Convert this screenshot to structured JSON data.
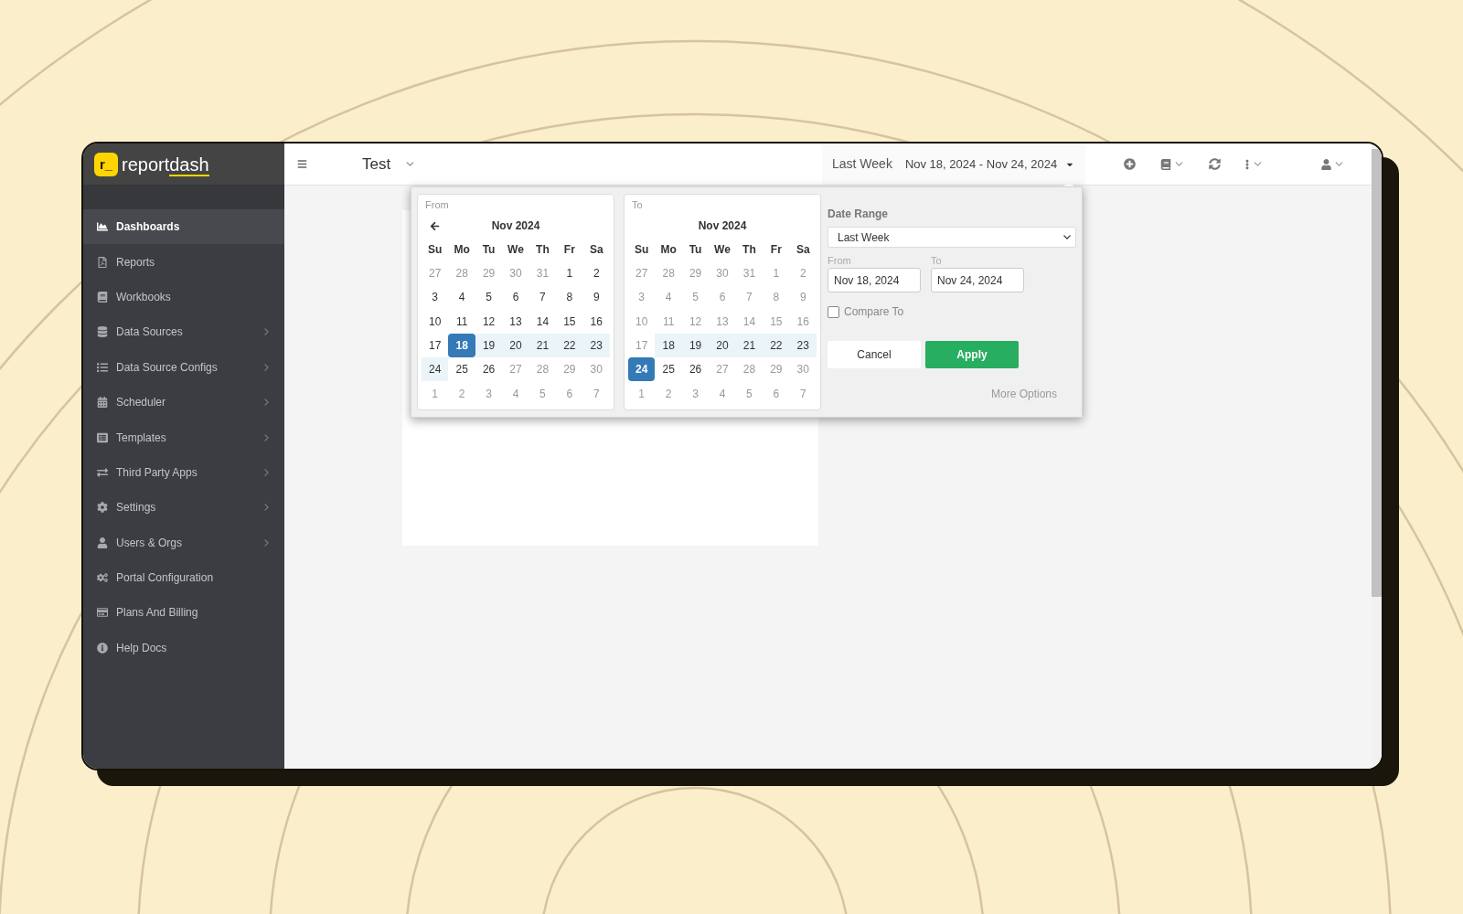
{
  "sidebar": {
    "logo": {
      "mark": "r_",
      "wordmark": "report",
      "wordmark_underlined_part": "dash"
    },
    "items": [
      {
        "label": "Dashboards",
        "selected": true,
        "has_submenu": false
      },
      {
        "label": "Reports",
        "selected": false,
        "has_submenu": false
      },
      {
        "label": "Workbooks",
        "selected": false,
        "has_submenu": false
      },
      {
        "label": "Data Sources",
        "selected": false,
        "has_submenu": true
      },
      {
        "label": "Data Source Configs",
        "selected": false,
        "has_submenu": true
      },
      {
        "label": "Scheduler",
        "selected": false,
        "has_submenu": true
      },
      {
        "label": "Templates",
        "selected": false,
        "has_submenu": true
      },
      {
        "label": "Third Party Apps",
        "selected": false,
        "has_submenu": true
      },
      {
        "label": "Settings",
        "selected": false,
        "has_submenu": true
      },
      {
        "label": "Users & Orgs",
        "selected": false,
        "has_submenu": true
      },
      {
        "label": "Portal Configuration",
        "selected": false,
        "has_submenu": false
      },
      {
        "label": "Plans And Billing",
        "selected": false,
        "has_submenu": false
      },
      {
        "label": "Help Docs",
        "selected": false,
        "has_submenu": false
      }
    ]
  },
  "top_bar": {
    "dashboard_title": "Test",
    "date_button": {
      "preset": "Last Week",
      "range": "Nov 18, 2024 - Nov 24, 2024"
    }
  },
  "date_picker": {
    "calendars": [
      {
        "label": "From",
        "month": "Nov 2024",
        "prev_arrow": true,
        "weekdays": [
          "Su",
          "Mo",
          "Tu",
          "We",
          "Th",
          "Fr",
          "Sa"
        ],
        "weeks": [
          [
            {
              "day": "27",
              "muted": true,
              "in_range": false,
              "selected": false
            },
            {
              "day": "28",
              "muted": true,
              "in_range": false,
              "selected": false
            },
            {
              "day": "29",
              "muted": true,
              "in_range": false,
              "selected": false
            },
            {
              "day": "30",
              "muted": true,
              "in_range": false,
              "selected": false
            },
            {
              "day": "31",
              "muted": true,
              "in_range": false,
              "selected": false
            },
            {
              "day": "1",
              "muted": false,
              "in_range": false,
              "selected": false
            },
            {
              "day": "2",
              "muted": false,
              "in_range": false,
              "selected": false
            }
          ],
          [
            {
              "day": "3",
              "muted": false,
              "in_range": false,
              "selected": false
            },
            {
              "day": "4",
              "muted": false,
              "in_range": false,
              "selected": false
            },
            {
              "day": "5",
              "muted": false,
              "in_range": false,
              "selected": false
            },
            {
              "day": "6",
              "muted": false,
              "in_range": false,
              "selected": false
            },
            {
              "day": "7",
              "muted": false,
              "in_range": false,
              "selected": false
            },
            {
              "day": "8",
              "muted": false,
              "in_range": false,
              "selected": false
            },
            {
              "day": "9",
              "muted": false,
              "in_range": false,
              "selected": false
            }
          ],
          [
            {
              "day": "10",
              "muted": false,
              "in_range": false,
              "selected": false
            },
            {
              "day": "11",
              "muted": false,
              "in_range": false,
              "selected": false
            },
            {
              "day": "12",
              "muted": false,
              "in_range": false,
              "selected": false
            },
            {
              "day": "13",
              "muted": false,
              "in_range": false,
              "selected": false
            },
            {
              "day": "14",
              "muted": false,
              "in_range": false,
              "selected": false
            },
            {
              "day": "15",
              "muted": false,
              "in_range": false,
              "selected": false
            },
            {
              "day": "16",
              "muted": false,
              "in_range": false,
              "selected": false
            }
          ],
          [
            {
              "day": "17",
              "muted": false,
              "in_range": false,
              "selected": false
            },
            {
              "day": "18",
              "muted": false,
              "in_range": false,
              "selected": true
            },
            {
              "day": "19",
              "muted": false,
              "in_range": true,
              "selected": false
            },
            {
              "day": "20",
              "muted": false,
              "in_range": true,
              "selected": false
            },
            {
              "day": "21",
              "muted": false,
              "in_range": true,
              "selected": false
            },
            {
              "day": "22",
              "muted": false,
              "in_range": true,
              "selected": false
            },
            {
              "day": "23",
              "muted": false,
              "in_range": true,
              "selected": false
            }
          ],
          [
            {
              "day": "24",
              "muted": false,
              "in_range": true,
              "selected": false
            },
            {
              "day": "25",
              "muted": false,
              "in_range": false,
              "selected": false
            },
            {
              "day": "26",
              "muted": false,
              "in_range": false,
              "selected": false
            },
            {
              "day": "27",
              "muted": true,
              "in_range": false,
              "selected": false
            },
            {
              "day": "28",
              "muted": true,
              "in_range": false,
              "selected": false
            },
            {
              "day": "29",
              "muted": true,
              "in_range": false,
              "selected": false
            },
            {
              "day": "30",
              "muted": true,
              "in_range": false,
              "selected": false
            }
          ],
          [
            {
              "day": "1",
              "muted": true,
              "in_range": false,
              "selected": false
            },
            {
              "day": "2",
              "muted": true,
              "in_range": false,
              "selected": false
            },
            {
              "day": "3",
              "muted": true,
              "in_range": false,
              "selected": false
            },
            {
              "day": "4",
              "muted": true,
              "in_range": false,
              "selected": false
            },
            {
              "day": "5",
              "muted": true,
              "in_range": false,
              "selected": false
            },
            {
              "day": "6",
              "muted": true,
              "in_range": false,
              "selected": false
            },
            {
              "day": "7",
              "muted": true,
              "in_range": false,
              "selected": false
            }
          ]
        ]
      },
      {
        "label": "To",
        "month": "Nov 2024",
        "prev_arrow": false,
        "weekdays": [
          "Su",
          "Mo",
          "Tu",
          "We",
          "Th",
          "Fr",
          "Sa"
        ],
        "weeks": [
          [
            {
              "day": "27",
              "muted": true,
              "in_range": false,
              "selected": false
            },
            {
              "day": "28",
              "muted": true,
              "in_range": false,
              "selected": false
            },
            {
              "day": "29",
              "muted": true,
              "in_range": false,
              "selected": false
            },
            {
              "day": "30",
              "muted": true,
              "in_range": false,
              "selected": false
            },
            {
              "day": "31",
              "muted": true,
              "in_range": false,
              "selected": false
            },
            {
              "day": "1",
              "muted": true,
              "in_range": false,
              "selected": false
            },
            {
              "day": "2",
              "muted": true,
              "in_range": false,
              "selected": false
            }
          ],
          [
            {
              "day": "3",
              "muted": true,
              "in_range": false,
              "selected": false
            },
            {
              "day": "4",
              "muted": true,
              "in_range": false,
              "selected": false
            },
            {
              "day": "5",
              "muted": true,
              "in_range": false,
              "selected": false
            },
            {
              "day": "6",
              "muted": true,
              "in_range": false,
              "selected": false
            },
            {
              "day": "7",
              "muted": true,
              "in_range": false,
              "selected": false
            },
            {
              "day": "8",
              "muted": true,
              "in_range": false,
              "selected": false
            },
            {
              "day": "9",
              "muted": true,
              "in_range": false,
              "selected": false
            }
          ],
          [
            {
              "day": "10",
              "muted": true,
              "in_range": false,
              "selected": false
            },
            {
              "day": "11",
              "muted": true,
              "in_range": false,
              "selected": false
            },
            {
              "day": "12",
              "muted": true,
              "in_range": false,
              "selected": false
            },
            {
              "day": "13",
              "muted": true,
              "in_range": false,
              "selected": false
            },
            {
              "day": "14",
              "muted": true,
              "in_range": false,
              "selected": false
            },
            {
              "day": "15",
              "muted": true,
              "in_range": false,
              "selected": false
            },
            {
              "day": "16",
              "muted": true,
              "in_range": false,
              "selected": false
            }
          ],
          [
            {
              "day": "17",
              "muted": true,
              "in_range": false,
              "selected": false
            },
            {
              "day": "18",
              "muted": false,
              "in_range": true,
              "selected": false
            },
            {
              "day": "19",
              "muted": false,
              "in_range": true,
              "selected": false
            },
            {
              "day": "20",
              "muted": false,
              "in_range": true,
              "selected": false
            },
            {
              "day": "21",
              "muted": false,
              "in_range": true,
              "selected": false
            },
            {
              "day": "22",
              "muted": false,
              "in_range": true,
              "selected": false
            },
            {
              "day": "23",
              "muted": false,
              "in_range": true,
              "selected": false
            }
          ],
          [
            {
              "day": "24",
              "muted": false,
              "in_range": false,
              "selected": true
            },
            {
              "day": "25",
              "muted": false,
              "in_range": false,
              "selected": false
            },
            {
              "day": "26",
              "muted": false,
              "in_range": false,
              "selected": false
            },
            {
              "day": "27",
              "muted": true,
              "in_range": false,
              "selected": false
            },
            {
              "day": "28",
              "muted": true,
              "in_range": false,
              "selected": false
            },
            {
              "day": "29",
              "muted": true,
              "in_range": false,
              "selected": false
            },
            {
              "day": "30",
              "muted": true,
              "in_range": false,
              "selected": false
            }
          ],
          [
            {
              "day": "1",
              "muted": true,
              "in_range": false,
              "selected": false
            },
            {
              "day": "2",
              "muted": true,
              "in_range": false,
              "selected": false
            },
            {
              "day": "3",
              "muted": true,
              "in_range": false,
              "selected": false
            },
            {
              "day": "4",
              "muted": true,
              "in_range": false,
              "selected": false
            },
            {
              "day": "5",
              "muted": true,
              "in_range": false,
              "selected": false
            },
            {
              "day": "6",
              "muted": true,
              "in_range": false,
              "selected": false
            },
            {
              "day": "7",
              "muted": true,
              "in_range": false,
              "selected": false
            }
          ]
        ]
      }
    ],
    "date_range": {
      "label": "Date Range",
      "value": "Last Week"
    },
    "from": {
      "label": "From",
      "value": "Nov 18, 2024"
    },
    "to": {
      "label": "To",
      "value": "Nov 24, 2024"
    },
    "compare": {
      "label": "Compare To",
      "checked": false
    },
    "buttons": [
      {
        "label": "Cancel",
        "kind": "secondary"
      },
      {
        "label": "Apply",
        "kind": "primary"
      }
    ],
    "more_options": "More Options"
  }
}
